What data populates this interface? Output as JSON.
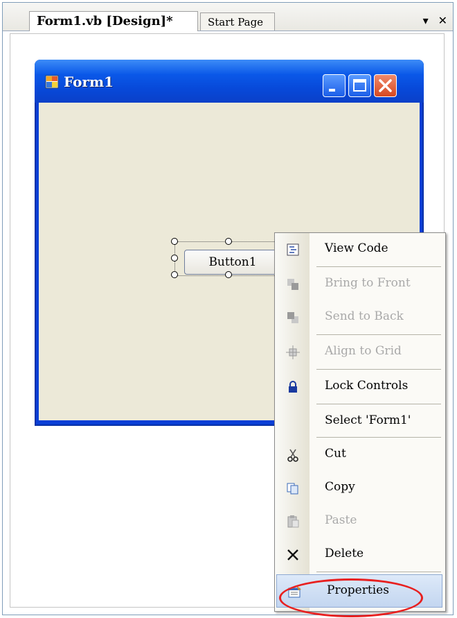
{
  "tabs": [
    {
      "label": "Form1.vb [Design]*"
    },
    {
      "label": "Start Page"
    }
  ],
  "tab_controls": {
    "dropdown": "▾",
    "close": "✕"
  },
  "form": {
    "title": "Form1",
    "button_label": "Button1"
  },
  "context_menu": {
    "items": [
      {
        "label": "View Code",
        "icon": "view-code-icon",
        "enabled": true
      },
      {
        "label": "Bring to Front",
        "icon": "bring-to-front-icon",
        "enabled": false
      },
      {
        "label": "Send to Back",
        "icon": "send-to-back-icon",
        "enabled": false
      },
      {
        "label": "Align to Grid",
        "icon": "align-to-grid-icon",
        "enabled": false
      },
      {
        "label": "Lock Controls",
        "icon": "lock-icon",
        "enabled": true
      },
      {
        "label": "Select 'Form1'",
        "icon": "",
        "enabled": true
      },
      {
        "label": "Cut",
        "icon": "scissors-icon",
        "enabled": true
      },
      {
        "label": "Copy",
        "icon": "copy-icon",
        "enabled": true
      },
      {
        "label": "Paste",
        "icon": "paste-icon",
        "enabled": false
      },
      {
        "label": "Delete",
        "icon": "delete-icon",
        "enabled": true
      },
      {
        "label": "Properties",
        "icon": "properties-icon",
        "enabled": true
      }
    ]
  },
  "colors": {
    "title_bar": "#0a58e8",
    "form_background": "#ece9d8",
    "highlight_ring": "#e82020"
  }
}
